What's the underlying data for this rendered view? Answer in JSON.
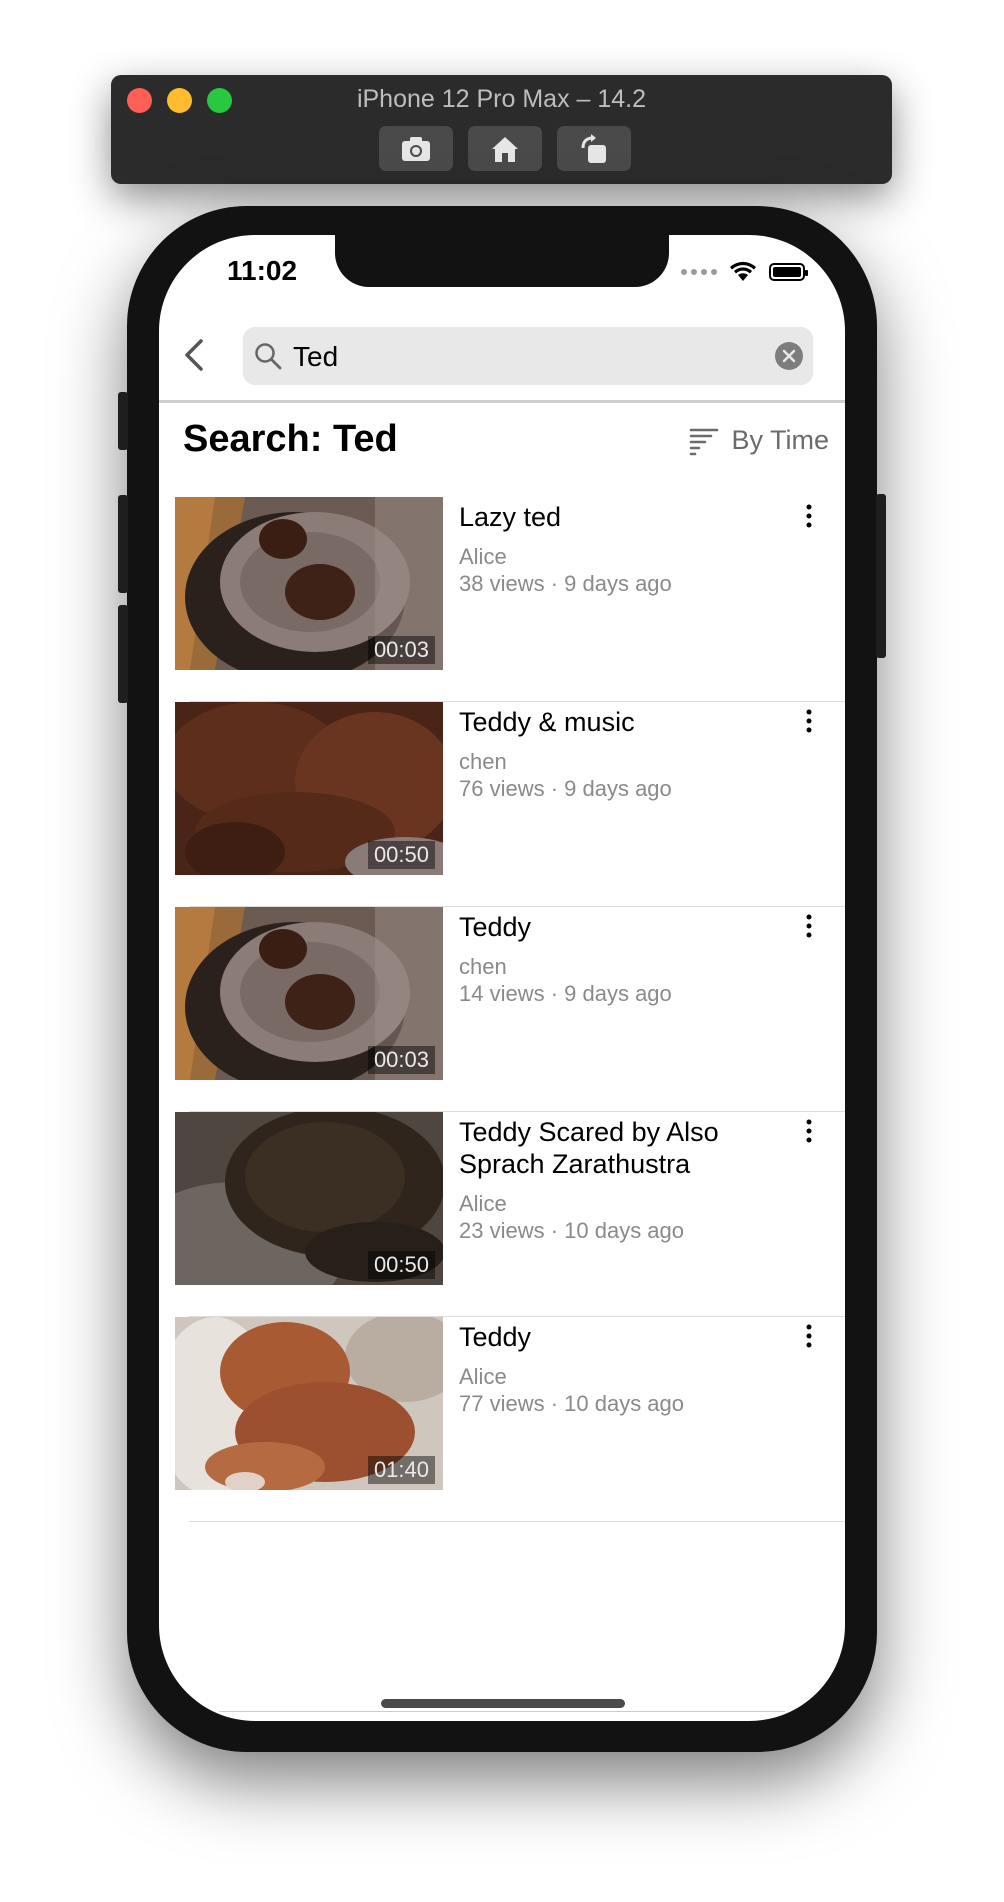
{
  "simulator": {
    "title": "iPhone 12 Pro Max – 14.2",
    "buttons": [
      {
        "name": "screenshot-button",
        "icon": "camera-icon"
      },
      {
        "name": "home-button",
        "icon": "house-icon"
      },
      {
        "name": "rotate-button",
        "icon": "rotate-icon"
      }
    ]
  },
  "status_bar": {
    "time": "11:02",
    "icons": [
      "cellular-icon",
      "wifi-icon",
      "battery-icon"
    ]
  },
  "search": {
    "query": "Ted",
    "icon": "search-icon",
    "clear_icon": "clear-icon",
    "back_icon": "chevron-left-icon"
  },
  "page": {
    "title": "Search: Ted",
    "sort_label": "By Time",
    "sort_icon": "sort-icon"
  },
  "results": [
    {
      "title": "Lazy ted",
      "channel": "Alice",
      "meta": "38 views · 9 days ago",
      "duration": "00:03",
      "thumb": "poodle-on-bed"
    },
    {
      "title": "Teddy & music",
      "channel": "chen",
      "meta": "76 views · 9 days ago",
      "duration": "00:50",
      "thumb": "poodle-closeup"
    },
    {
      "title": "Teddy",
      "channel": "chen",
      "meta": "14 views · 9 days ago",
      "duration": "00:03",
      "thumb": "poodle-on-bed"
    },
    {
      "title": "Teddy Scared by Also Sprach Zarathustra",
      "channel": "Alice",
      "meta": "23 views · 10 days ago",
      "duration": "00:50",
      "thumb": "poodle-dark"
    },
    {
      "title": "Teddy",
      "channel": "Alice",
      "meta": "77 views · 10 days ago",
      "duration": "01:40",
      "thumb": "poodle-light"
    }
  ],
  "colors": {
    "accent_gray": "#8a8a8a",
    "search_bg": "#e8e8e8",
    "device": "#121212"
  }
}
